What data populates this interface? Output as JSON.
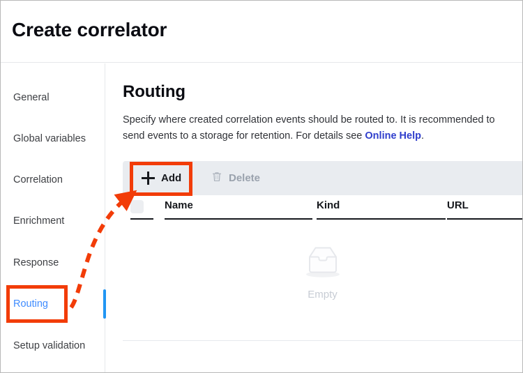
{
  "window": {
    "title": "Create correlator"
  },
  "sidebar": {
    "items": [
      {
        "label": "General",
        "active": false
      },
      {
        "label": "Global variables",
        "active": false
      },
      {
        "label": "Correlation",
        "active": false
      },
      {
        "label": "Enrichment",
        "active": false
      },
      {
        "label": "Response",
        "active": false
      },
      {
        "label": "Routing",
        "active": true
      },
      {
        "label": "Setup validation",
        "active": false
      }
    ]
  },
  "main": {
    "section_title": "Routing",
    "description_part1": "Specify where created correlation events should be routed to. It is recommended to send events to a storage for retention. For details see ",
    "description_link": "Online Help",
    "description_part2": ".",
    "toolbar": {
      "add_label": "Add",
      "delete_label": "Delete"
    },
    "table": {
      "columns": [
        "Name",
        "Kind",
        "URL"
      ],
      "rows": [],
      "empty_label": "Empty"
    }
  },
  "annotations": {
    "highlight_color": "#f23c08",
    "boxes": [
      "routing-nav-item",
      "add-button"
    ],
    "arrow": "routing-to-add"
  },
  "colors": {
    "accent_blue": "#3f8cff",
    "selection_bar": "#2196f3",
    "link": "#2f3ecc",
    "toolbar_bg": "#e9ecf0",
    "annotation": "#f23c08"
  }
}
